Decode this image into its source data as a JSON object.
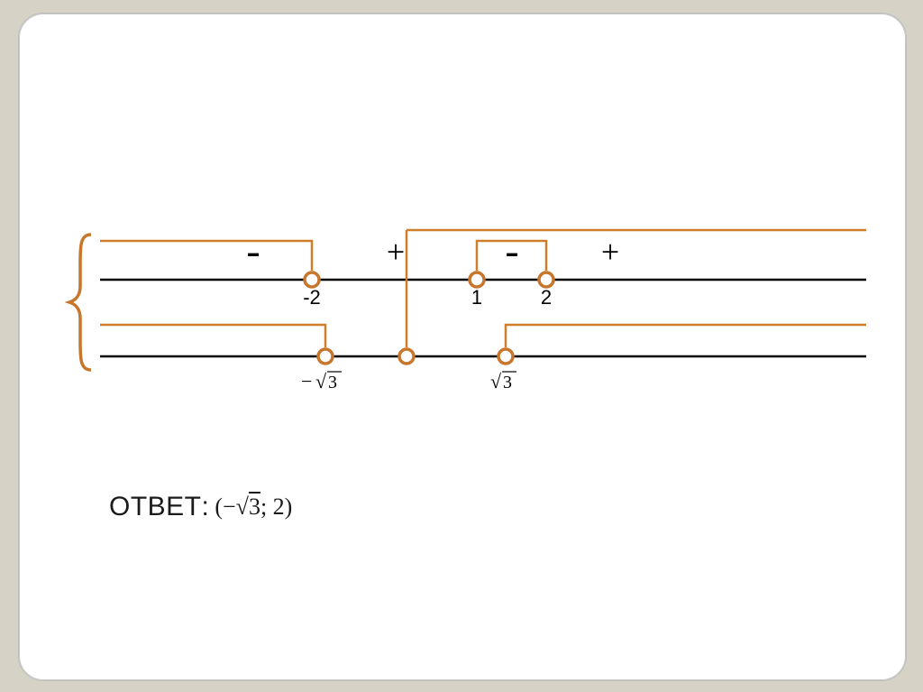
{
  "diagram": {
    "signs_top": [
      "-",
      "+",
      "-",
      "+"
    ],
    "points_top": [
      "-2",
      "1",
      "2"
    ],
    "points_bottom": [
      "−√3",
      "√3"
    ]
  },
  "answer": {
    "label": "ОТВЕТ:",
    "value": "(−√3; 2)"
  }
}
